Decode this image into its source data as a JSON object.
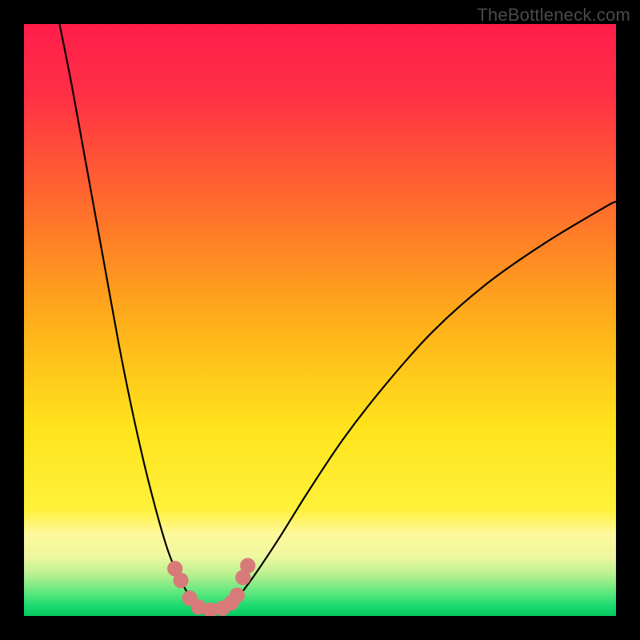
{
  "watermark": "TheBottleneck.com",
  "chart_data": {
    "type": "line",
    "title": "",
    "xlabel": "",
    "ylabel": "",
    "xlim": [
      0,
      100
    ],
    "ylim": [
      0,
      100
    ],
    "note": "No numeric axes or labels are rendered in the image; x and y are unlabeled 0–100 normalized coordinates. The two black curves form a V-shape whose minimum touches a thin green band at the bottom. Coral markers highlight points near the trough.",
    "series": [
      {
        "name": "curve-left",
        "color": "#000000",
        "x": [
          6,
          8,
          10,
          12,
          14,
          16,
          18,
          20,
          22,
          24,
          25.5,
          27,
          28.5,
          30
        ],
        "y": [
          100,
          90,
          79,
          68,
          57,
          46,
          36,
          27,
          19,
          12,
          8,
          5,
          2.5,
          1
        ]
      },
      {
        "name": "curve-right",
        "color": "#000000",
        "x": [
          34,
          36,
          39,
          43,
          48,
          54,
          61,
          69,
          78,
          88,
          98,
          100
        ],
        "y": [
          1,
          3,
          7,
          13,
          21,
          30,
          39,
          48,
          56,
          63,
          69,
          70
        ]
      },
      {
        "name": "valley-floor",
        "color": "#d87a7a",
        "x": [
          28,
          30,
          32,
          34,
          36
        ],
        "y": [
          2.5,
          1.2,
          1.0,
          1.2,
          2.5
        ]
      }
    ],
    "markers": [
      {
        "x": 25.5,
        "y": 8,
        "r": 1.3,
        "color": "#d87a7a"
      },
      {
        "x": 26.5,
        "y": 6,
        "r": 1.3,
        "color": "#d87a7a"
      },
      {
        "x": 28.0,
        "y": 3,
        "r": 1.3,
        "color": "#d87a7a"
      },
      {
        "x": 29.5,
        "y": 1.5,
        "r": 1.3,
        "color": "#d87a7a"
      },
      {
        "x": 31.5,
        "y": 1.0,
        "r": 1.3,
        "color": "#d87a7a"
      },
      {
        "x": 33.5,
        "y": 1.3,
        "r": 1.3,
        "color": "#d87a7a"
      },
      {
        "x": 35.0,
        "y": 2.2,
        "r": 1.3,
        "color": "#d87a7a"
      },
      {
        "x": 36.0,
        "y": 3.5,
        "r": 1.3,
        "color": "#d87a7a"
      },
      {
        "x": 37.0,
        "y": 6.5,
        "r": 1.3,
        "color": "#d87a7a"
      },
      {
        "x": 37.8,
        "y": 8.5,
        "r": 1.3,
        "color": "#d87a7a"
      }
    ],
    "gradient_stops": [
      {
        "offset": 0.0,
        "color": "#ff1e4b"
      },
      {
        "offset": 0.12,
        "color": "#ff3045"
      },
      {
        "offset": 0.3,
        "color": "#ff6a2d"
      },
      {
        "offset": 0.5,
        "color": "#ffae1a"
      },
      {
        "offset": 0.68,
        "color": "#ffe31c"
      },
      {
        "offset": 0.82,
        "color": "#fff13a"
      },
      {
        "offset": 0.86,
        "color": "#fff89a"
      },
      {
        "offset": 0.9,
        "color": "#eef7a0"
      },
      {
        "offset": 0.93,
        "color": "#b8f090"
      },
      {
        "offset": 0.96,
        "color": "#5fe87f"
      },
      {
        "offset": 0.985,
        "color": "#17d96e"
      },
      {
        "offset": 1.0,
        "color": "#06c85f"
      }
    ]
  }
}
